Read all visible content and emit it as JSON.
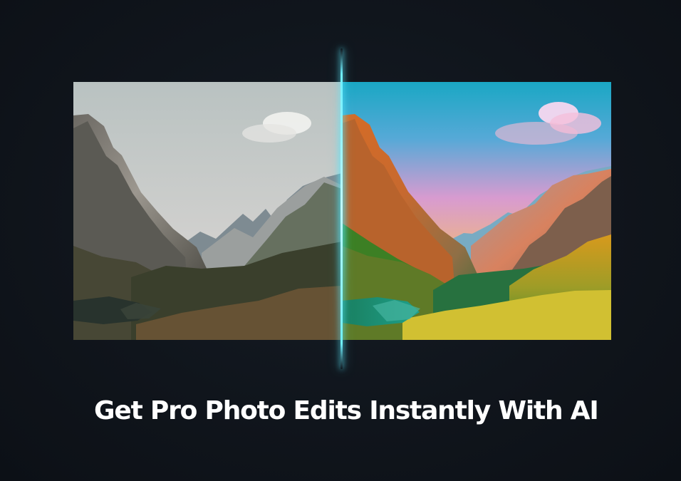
{
  "headline": "Get Pro Photo Edits Instantly With AI",
  "comparison": {
    "before_image": "muted mountain valley photo",
    "after_image": "vivid color graded mountain valley photo",
    "divider_color": "#61eaff"
  }
}
